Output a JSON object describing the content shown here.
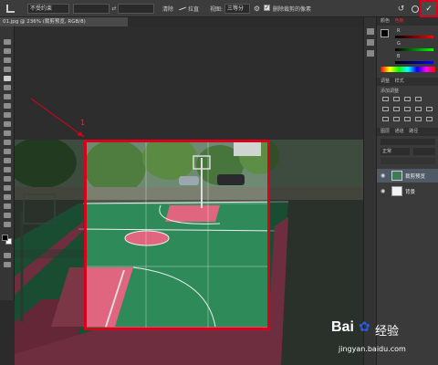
{
  "options_bar": {
    "style_value": "不受约束",
    "clear_label": "清除",
    "straighten_label": "拉直",
    "view_label": "视图:",
    "view_value": "三等分",
    "delete_cropped_label": "删除裁剪的像素",
    "icons": [
      "crop-icon",
      "swap-icon",
      "straighten-icon",
      "gear-icon",
      "undo-icon",
      "cancel-icon",
      "commit-icon"
    ]
  },
  "document_tab": {
    "title": "01.jpg @ 236% (裁剪预览, RGB/8)"
  },
  "annotation": {
    "number": "1"
  },
  "panels": {
    "color_tabs": [
      "颜色",
      "色板"
    ],
    "channel_labels": [
      "R",
      "G",
      "B"
    ],
    "adjust_tabs": [
      "调整",
      "样式"
    ],
    "adjust_hint": "添加调整",
    "layer_tabs": [
      "图层",
      "通道",
      "路径"
    ],
    "blend_mode": "正常",
    "layers": [
      {
        "name": "裁剪预览",
        "selected": true
      },
      {
        "name": "背景",
        "selected": false
      }
    ]
  },
  "watermark": {
    "brand": "Bai",
    "brand_suffix": "经验",
    "url": "jingyan.baidu.com"
  },
  "colors": {
    "highlight": "#d9001b",
    "court_green": "#2f8a5a",
    "court_red": "#c95574",
    "baidu_blue": "#2a5bd7"
  }
}
